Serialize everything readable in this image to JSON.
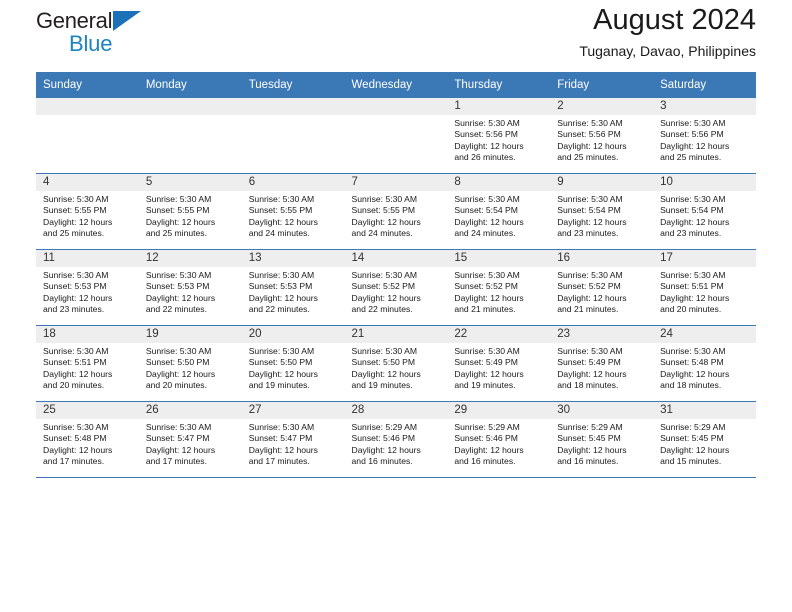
{
  "brand": {
    "name_part1": "General",
    "name_part2": "Blue",
    "triangle_color": "#1d71b8",
    "blue_color": "#1d84c4"
  },
  "header": {
    "title": "August 2024",
    "subtitle": "Tuganay, Davao, Philippines"
  },
  "theme": {
    "header_bg": "#3b78b6",
    "daynum_band_bg": "#eeeeee",
    "row_separator": "#3b78b6"
  },
  "weekday_headers": [
    "Sunday",
    "Monday",
    "Tuesday",
    "Wednesday",
    "Thursday",
    "Friday",
    "Saturday"
  ],
  "weeks": [
    [
      {
        "day": "",
        "sunrise": "",
        "sunset": "",
        "daylight_line1": "",
        "daylight_line2": "",
        "empty": true
      },
      {
        "day": "",
        "sunrise": "",
        "sunset": "",
        "daylight_line1": "",
        "daylight_line2": "",
        "empty": true
      },
      {
        "day": "",
        "sunrise": "",
        "sunset": "",
        "daylight_line1": "",
        "daylight_line2": "",
        "empty": true
      },
      {
        "day": "",
        "sunrise": "",
        "sunset": "",
        "daylight_line1": "",
        "daylight_line2": "",
        "empty": true
      },
      {
        "day": "1",
        "sunrise": "Sunrise: 5:30 AM",
        "sunset": "Sunset: 5:56 PM",
        "daylight_line1": "Daylight: 12 hours",
        "daylight_line2": "and 26 minutes.",
        "empty": false
      },
      {
        "day": "2",
        "sunrise": "Sunrise: 5:30 AM",
        "sunset": "Sunset: 5:56 PM",
        "daylight_line1": "Daylight: 12 hours",
        "daylight_line2": "and 25 minutes.",
        "empty": false
      },
      {
        "day": "3",
        "sunrise": "Sunrise: 5:30 AM",
        "sunset": "Sunset: 5:56 PM",
        "daylight_line1": "Daylight: 12 hours",
        "daylight_line2": "and 25 minutes.",
        "empty": false
      }
    ],
    [
      {
        "day": "4",
        "sunrise": "Sunrise: 5:30 AM",
        "sunset": "Sunset: 5:55 PM",
        "daylight_line1": "Daylight: 12 hours",
        "daylight_line2": "and 25 minutes.",
        "empty": false
      },
      {
        "day": "5",
        "sunrise": "Sunrise: 5:30 AM",
        "sunset": "Sunset: 5:55 PM",
        "daylight_line1": "Daylight: 12 hours",
        "daylight_line2": "and 25 minutes.",
        "empty": false
      },
      {
        "day": "6",
        "sunrise": "Sunrise: 5:30 AM",
        "sunset": "Sunset: 5:55 PM",
        "daylight_line1": "Daylight: 12 hours",
        "daylight_line2": "and 24 minutes.",
        "empty": false
      },
      {
        "day": "7",
        "sunrise": "Sunrise: 5:30 AM",
        "sunset": "Sunset: 5:55 PM",
        "daylight_line1": "Daylight: 12 hours",
        "daylight_line2": "and 24 minutes.",
        "empty": false
      },
      {
        "day": "8",
        "sunrise": "Sunrise: 5:30 AM",
        "sunset": "Sunset: 5:54 PM",
        "daylight_line1": "Daylight: 12 hours",
        "daylight_line2": "and 24 minutes.",
        "empty": false
      },
      {
        "day": "9",
        "sunrise": "Sunrise: 5:30 AM",
        "sunset": "Sunset: 5:54 PM",
        "daylight_line1": "Daylight: 12 hours",
        "daylight_line2": "and 23 minutes.",
        "empty": false
      },
      {
        "day": "10",
        "sunrise": "Sunrise: 5:30 AM",
        "sunset": "Sunset: 5:54 PM",
        "daylight_line1": "Daylight: 12 hours",
        "daylight_line2": "and 23 minutes.",
        "empty": false
      }
    ],
    [
      {
        "day": "11",
        "sunrise": "Sunrise: 5:30 AM",
        "sunset": "Sunset: 5:53 PM",
        "daylight_line1": "Daylight: 12 hours",
        "daylight_line2": "and 23 minutes.",
        "empty": false
      },
      {
        "day": "12",
        "sunrise": "Sunrise: 5:30 AM",
        "sunset": "Sunset: 5:53 PM",
        "daylight_line1": "Daylight: 12 hours",
        "daylight_line2": "and 22 minutes.",
        "empty": false
      },
      {
        "day": "13",
        "sunrise": "Sunrise: 5:30 AM",
        "sunset": "Sunset: 5:53 PM",
        "daylight_line1": "Daylight: 12 hours",
        "daylight_line2": "and 22 minutes.",
        "empty": false
      },
      {
        "day": "14",
        "sunrise": "Sunrise: 5:30 AM",
        "sunset": "Sunset: 5:52 PM",
        "daylight_line1": "Daylight: 12 hours",
        "daylight_line2": "and 22 minutes.",
        "empty": false
      },
      {
        "day": "15",
        "sunrise": "Sunrise: 5:30 AM",
        "sunset": "Sunset: 5:52 PM",
        "daylight_line1": "Daylight: 12 hours",
        "daylight_line2": "and 21 minutes.",
        "empty": false
      },
      {
        "day": "16",
        "sunrise": "Sunrise: 5:30 AM",
        "sunset": "Sunset: 5:52 PM",
        "daylight_line1": "Daylight: 12 hours",
        "daylight_line2": "and 21 minutes.",
        "empty": false
      },
      {
        "day": "17",
        "sunrise": "Sunrise: 5:30 AM",
        "sunset": "Sunset: 5:51 PM",
        "daylight_line1": "Daylight: 12 hours",
        "daylight_line2": "and 20 minutes.",
        "empty": false
      }
    ],
    [
      {
        "day": "18",
        "sunrise": "Sunrise: 5:30 AM",
        "sunset": "Sunset: 5:51 PM",
        "daylight_line1": "Daylight: 12 hours",
        "daylight_line2": "and 20 minutes.",
        "empty": false
      },
      {
        "day": "19",
        "sunrise": "Sunrise: 5:30 AM",
        "sunset": "Sunset: 5:50 PM",
        "daylight_line1": "Daylight: 12 hours",
        "daylight_line2": "and 20 minutes.",
        "empty": false
      },
      {
        "day": "20",
        "sunrise": "Sunrise: 5:30 AM",
        "sunset": "Sunset: 5:50 PM",
        "daylight_line1": "Daylight: 12 hours",
        "daylight_line2": "and 19 minutes.",
        "empty": false
      },
      {
        "day": "21",
        "sunrise": "Sunrise: 5:30 AM",
        "sunset": "Sunset: 5:50 PM",
        "daylight_line1": "Daylight: 12 hours",
        "daylight_line2": "and 19 minutes.",
        "empty": false
      },
      {
        "day": "22",
        "sunrise": "Sunrise: 5:30 AM",
        "sunset": "Sunset: 5:49 PM",
        "daylight_line1": "Daylight: 12 hours",
        "daylight_line2": "and 19 minutes.",
        "empty": false
      },
      {
        "day": "23",
        "sunrise": "Sunrise: 5:30 AM",
        "sunset": "Sunset: 5:49 PM",
        "daylight_line1": "Daylight: 12 hours",
        "daylight_line2": "and 18 minutes.",
        "empty": false
      },
      {
        "day": "24",
        "sunrise": "Sunrise: 5:30 AM",
        "sunset": "Sunset: 5:48 PM",
        "daylight_line1": "Daylight: 12 hours",
        "daylight_line2": "and 18 minutes.",
        "empty": false
      }
    ],
    [
      {
        "day": "25",
        "sunrise": "Sunrise: 5:30 AM",
        "sunset": "Sunset: 5:48 PM",
        "daylight_line1": "Daylight: 12 hours",
        "daylight_line2": "and 17 minutes.",
        "empty": false
      },
      {
        "day": "26",
        "sunrise": "Sunrise: 5:30 AM",
        "sunset": "Sunset: 5:47 PM",
        "daylight_line1": "Daylight: 12 hours",
        "daylight_line2": "and 17 minutes.",
        "empty": false
      },
      {
        "day": "27",
        "sunrise": "Sunrise: 5:30 AM",
        "sunset": "Sunset: 5:47 PM",
        "daylight_line1": "Daylight: 12 hours",
        "daylight_line2": "and 17 minutes.",
        "empty": false
      },
      {
        "day": "28",
        "sunrise": "Sunrise: 5:29 AM",
        "sunset": "Sunset: 5:46 PM",
        "daylight_line1": "Daylight: 12 hours",
        "daylight_line2": "and 16 minutes.",
        "empty": false
      },
      {
        "day": "29",
        "sunrise": "Sunrise: 5:29 AM",
        "sunset": "Sunset: 5:46 PM",
        "daylight_line1": "Daylight: 12 hours",
        "daylight_line2": "and 16 minutes.",
        "empty": false
      },
      {
        "day": "30",
        "sunrise": "Sunrise: 5:29 AM",
        "sunset": "Sunset: 5:45 PM",
        "daylight_line1": "Daylight: 12 hours",
        "daylight_line2": "and 16 minutes.",
        "empty": false
      },
      {
        "day": "31",
        "sunrise": "Sunrise: 5:29 AM",
        "sunset": "Sunset: 5:45 PM",
        "daylight_line1": "Daylight: 12 hours",
        "daylight_line2": "and 15 minutes.",
        "empty": false
      }
    ]
  ]
}
